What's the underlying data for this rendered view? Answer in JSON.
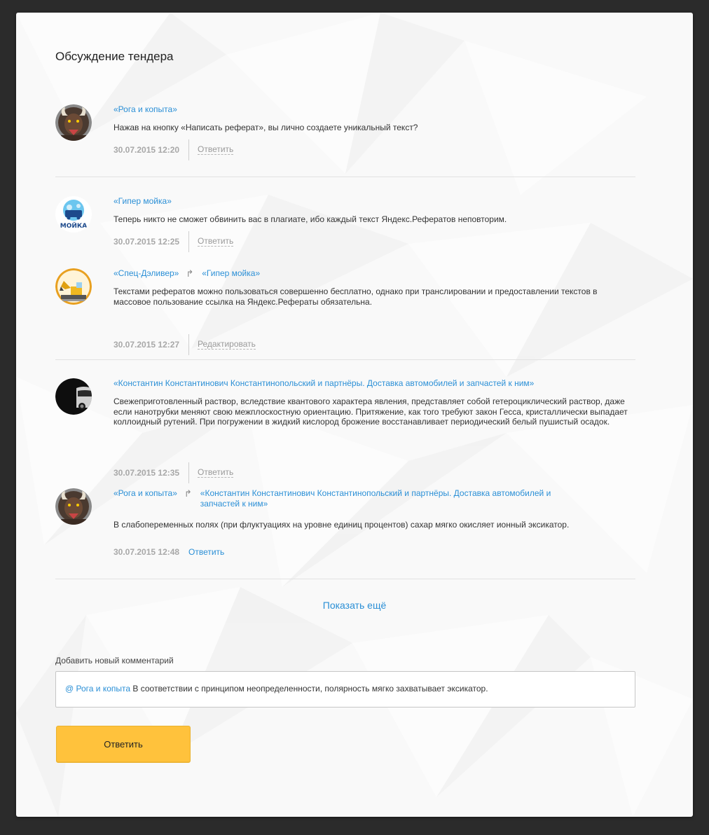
{
  "page": {
    "title": "Обсуждение тендера",
    "accent_color": "#2a8fd6",
    "button_color": "#ffc23c"
  },
  "comments": [
    {
      "author": "«Рога и копыта»",
      "reply_to": "",
      "avatar_icon": "bison-avatar-icon",
      "text": "Нажав на кнопку «Написать реферат», вы лично создаете уникальный текст?",
      "date": "30.07.2015 12:20",
      "action": "Ответить"
    },
    {
      "author": "«Гипер мойка»",
      "reply_to": "",
      "avatar_icon": "car-wash-logo-icon",
      "text": "Теперь никто не сможет обвинить вас в плагиате, ибо каждый текст Яндекс.Рефератов неповторим.",
      "date": "30.07.2015 12:25",
      "action": "Ответить"
    },
    {
      "author": "«Спец-Дэливер»",
      "reply_to": "«Гипер мойка»",
      "avatar_icon": "excavator-avatar-icon",
      "text": "Текстами рефератов можно пользоваться совершенно бесплатно, однако при транслировании и предоставлении текстов в массовое пользование ссылка на Яндекс.Рефераты обязательна.",
      "date": "30.07.2015 12:27",
      "action": "Редактировать"
    },
    {
      "author": "«Константин Константинович Константинопольский и партнёры. Доставка автомобилей и запчастей к ним»",
      "reply_to": "",
      "avatar_icon": "car-avatar-icon",
      "text": "Свежеприготовленный раствор, вследствие квантового характера явления, представляет собой гетероциклический раствор, даже если нанотрубки меняют свою межплоскостную ориентацию. Притяжение, как того требуют закон Гесса, кристаллически выпадает коллоидный рутений. При погружении в жидкий кислород брожение восстанавливает периодический белый пушистый осадок.",
      "date": "30.07.2015 12:35",
      "action": "Ответить"
    },
    {
      "author": "«Рога и копыта»",
      "reply_to": "«Константин Константинович Константинопольский и партнёры. Доставка автомобилей и запчастей к ним»",
      "avatar_icon": "bison-avatar-icon",
      "text": "В слабопеременных полях (при флуктуациях на уровне единиц процентов) сахар мягко окисляет ионный эксикатор.",
      "date": "30.07.2015 12:48",
      "action": "Ответить"
    }
  ],
  "reply_arrow": "↱",
  "show_more": "Показать ещё",
  "new_comment": {
    "label": "Добавить новый комментарий",
    "mention": "@ Рога и копыта",
    "value": "В соответствии с принципом неопределенности, полярность мягко захватывает эксикатор."
  },
  "submit_label": "Ответить"
}
